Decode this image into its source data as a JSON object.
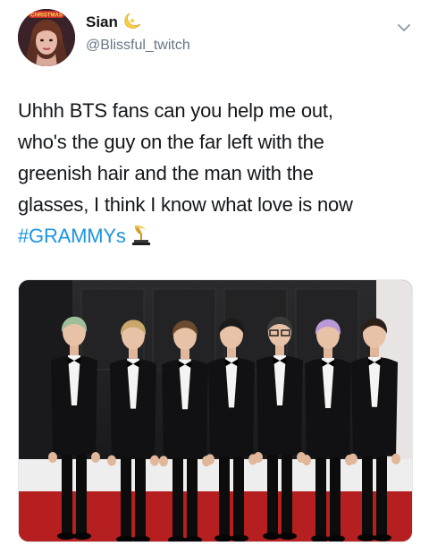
{
  "user": {
    "display_name": "Sian",
    "handle": "@Blissful_twitch",
    "avatar_badge": "CHRISTMAS"
  },
  "tweet": {
    "lines": [
      "Uhhh BTS fans can you help me out,",
      "who's the guy on the far left with the",
      "greenish hair and the man with the",
      "glasses, I think I know what love is now"
    ],
    "hashtag": "#GRAMMYs"
  },
  "icons": {
    "name_emoji": "crescent-moon-emoji",
    "trophy": "grammy-trophy-emoji",
    "menu": "chevron-down-icon"
  },
  "colors": {
    "text": "#14171a",
    "secondary": "#657786",
    "link": "#1b95e0",
    "carpet": "#b51f1f"
  }
}
